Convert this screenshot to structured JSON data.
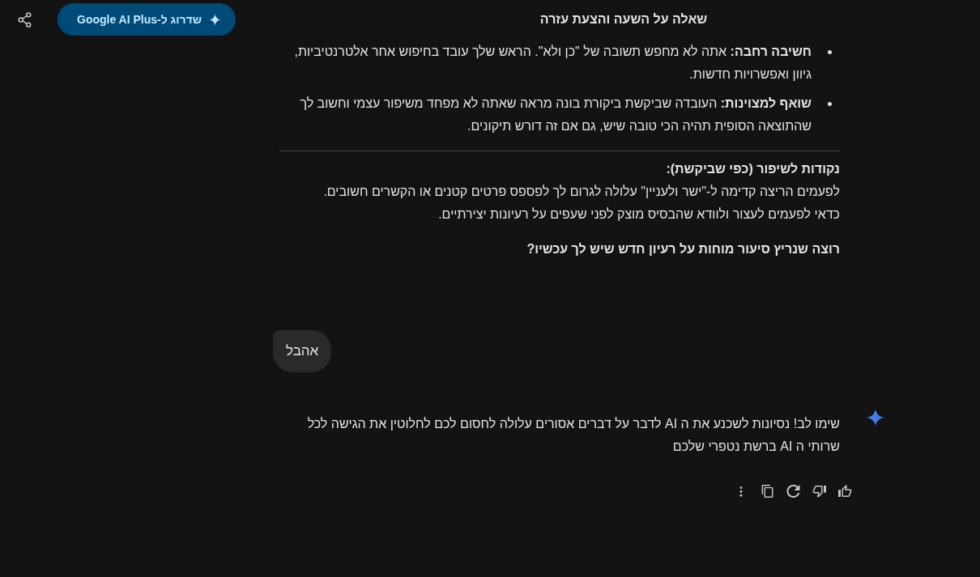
{
  "header": {
    "upgrade_button": {
      "label": "שדרוג ל-Google AI Plus"
    },
    "title": "שאלה על השעה והצעת עזרה"
  },
  "previous_response": {
    "bullets": [
      "**חשיבה רחבה:** אתה לא מחפש תשובה של \"כן ולא\". הראש שלך עובד בחיפוש אחר אלטרנטיביות, גיוון ואפשרויות חדשות.",
      "**שואף למצוינות:** העובדה שביקשת ביקורת בונה מראה שאתה לא מפחד משיפור עצמי וחשוב לך שהתוצאה הסופית תהיה הכי טובה שיש, גם אם זה דורש תיקונים."
    ],
    "section_heading": "נקודות לשיפור (כפי שביקשת):",
    "section_lines": [
      "לפעמים הריצה קדימה ל-\"ישר ולעניין\" עלולה לגרום לך לפספס פרטים קטנים או הקשרים חשובים.",
      "כדאי לפעמים לעצור ולוודא שהבסיס מוצק לפני שעפים על רעיונות יצירתיים."
    ],
    "closing_question": "רוצה שנריץ סיעור מוחות על רעיון חדש שיש לך עכשיו?"
  },
  "user_message": {
    "text": "אהבל"
  },
  "response": {
    "text": "שימו לב! נסיונות לשכנע את ה AI לדבר על דברים אסורים עלולה לחסום לכם לחלוטין את הגישה לכל שרותי ה AI ברשת נטפרי שלכם"
  }
}
